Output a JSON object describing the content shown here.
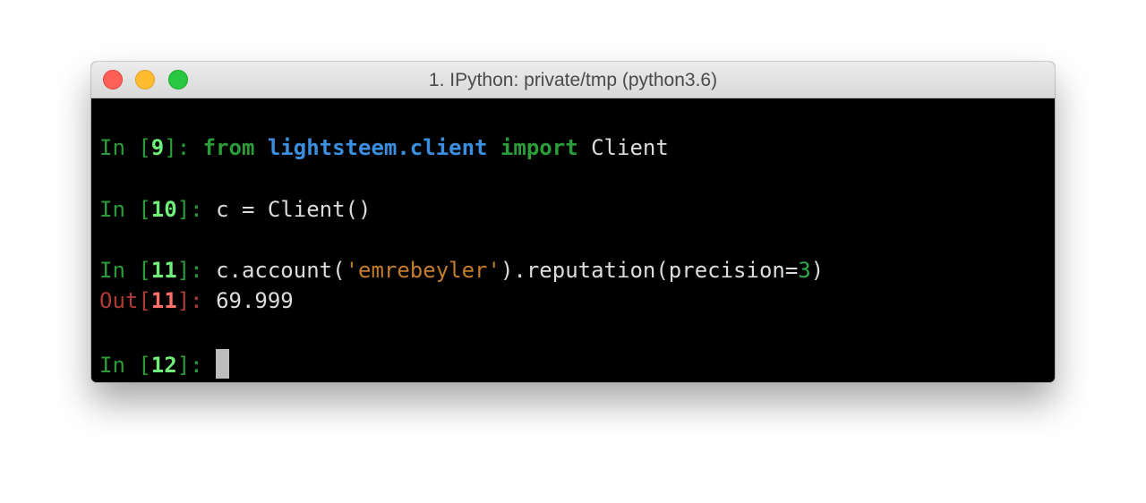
{
  "window": {
    "title": "1. IPython: private/tmp (python3.6)"
  },
  "terminal": {
    "lines": [
      {
        "prompt_label": "In [",
        "prompt_num": "9",
        "prompt_close": "]: ",
        "tokens": {
          "kw1": "from",
          "sp1": " ",
          "module": "lightsteem.client",
          "sp2": " ",
          "kw2": "import",
          "sp3": " ",
          "name": "Client"
        }
      },
      {
        "prompt_label": "In [",
        "prompt_num": "10",
        "prompt_close": "]: ",
        "code": "c = Client()"
      },
      {
        "prompt_label": "In [",
        "prompt_num": "11",
        "prompt_close": "]: ",
        "tokens": {
          "pre": "c.account(",
          "string": "'emrebeyler'",
          "mid": ").reputation(precision=",
          "number": "3",
          "post": ")"
        }
      },
      {
        "prompt_label": "Out[",
        "prompt_num": "11",
        "prompt_close": "]: ",
        "output": "69.999"
      },
      {
        "prompt_label": "In [",
        "prompt_num": "12",
        "prompt_close": "]: "
      }
    ]
  },
  "colors": {
    "prompt_in": "#2a9d3a",
    "prompt_in_number": "#6ff07a",
    "prompt_out": "#b23a36",
    "prompt_out_number": "#ff7068",
    "keyword": "#2a9d3a",
    "module": "#3b8fe0",
    "string": "#c27c2a",
    "number": "#2fa84f",
    "background": "#000000"
  }
}
